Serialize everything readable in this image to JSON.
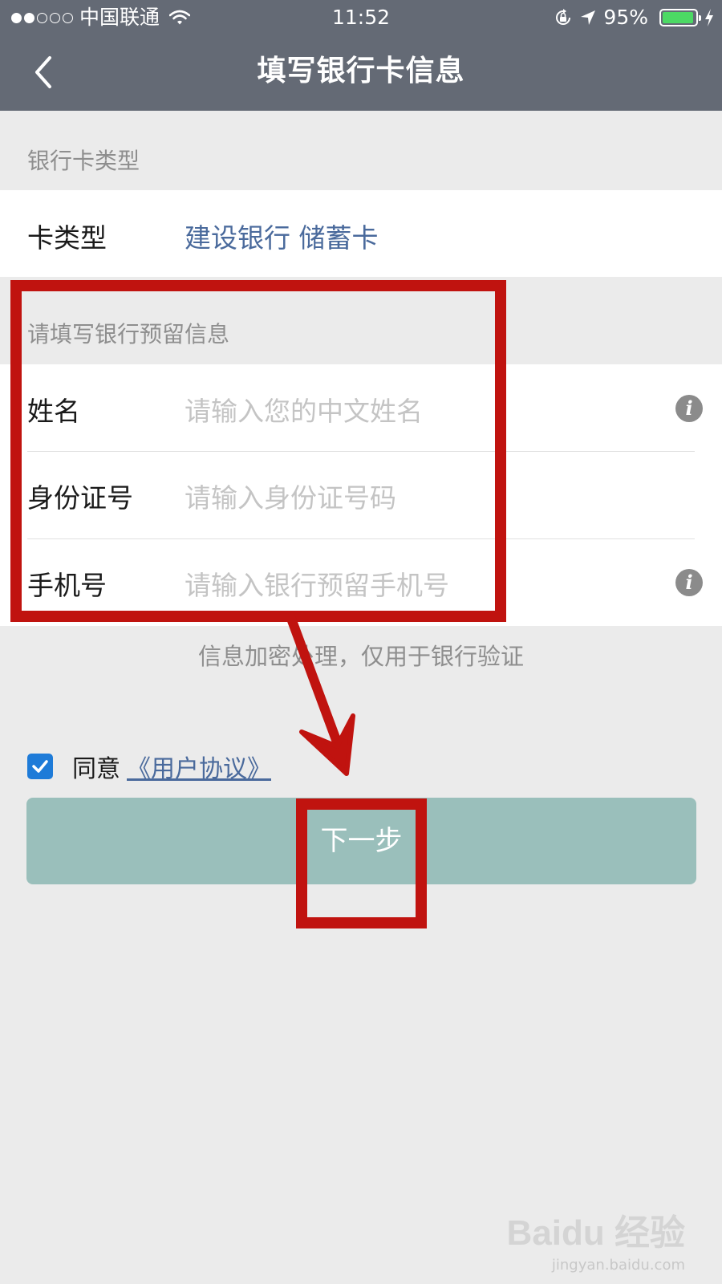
{
  "status_bar": {
    "carrier": "中国联通",
    "time": "11:52",
    "battery": "95%",
    "icons": [
      "signal-dots",
      "wifi-icon",
      "orientation-lock-icon",
      "location-arrow-icon",
      "battery-icon",
      "charging-bolt-icon"
    ]
  },
  "nav": {
    "title": "填写银行卡信息",
    "back_icon": "chevron-left-icon"
  },
  "card_section": {
    "header": "银行卡类型",
    "label": "卡类型",
    "value": "建设银行 储蓄卡"
  },
  "info_section": {
    "header": "请填写银行预留信息",
    "fields": [
      {
        "label": "姓名",
        "placeholder": "请输入您的中文姓名",
        "info_icon": true
      },
      {
        "label": "身份证号",
        "placeholder": "请输入身份证号码",
        "info_icon": false
      },
      {
        "label": "手机号",
        "placeholder": "请输入银行预留手机号",
        "info_icon": true
      }
    ],
    "info_icon_glyph": "i"
  },
  "hint": "信息加密处理，仅用于银行验证",
  "agreement": {
    "checked": true,
    "prefix": "同意",
    "link": "《用户协议》"
  },
  "next_button": "下一步",
  "watermark": {
    "logo": "Baidu 经验",
    "url": "jingyan.baidu.com"
  },
  "colors": {
    "nav_bg": "#646a75",
    "link": "#4a6a9c",
    "button": "#9abfbb",
    "checkbox": "#1e7bd8",
    "annotation": "#c0130f"
  }
}
